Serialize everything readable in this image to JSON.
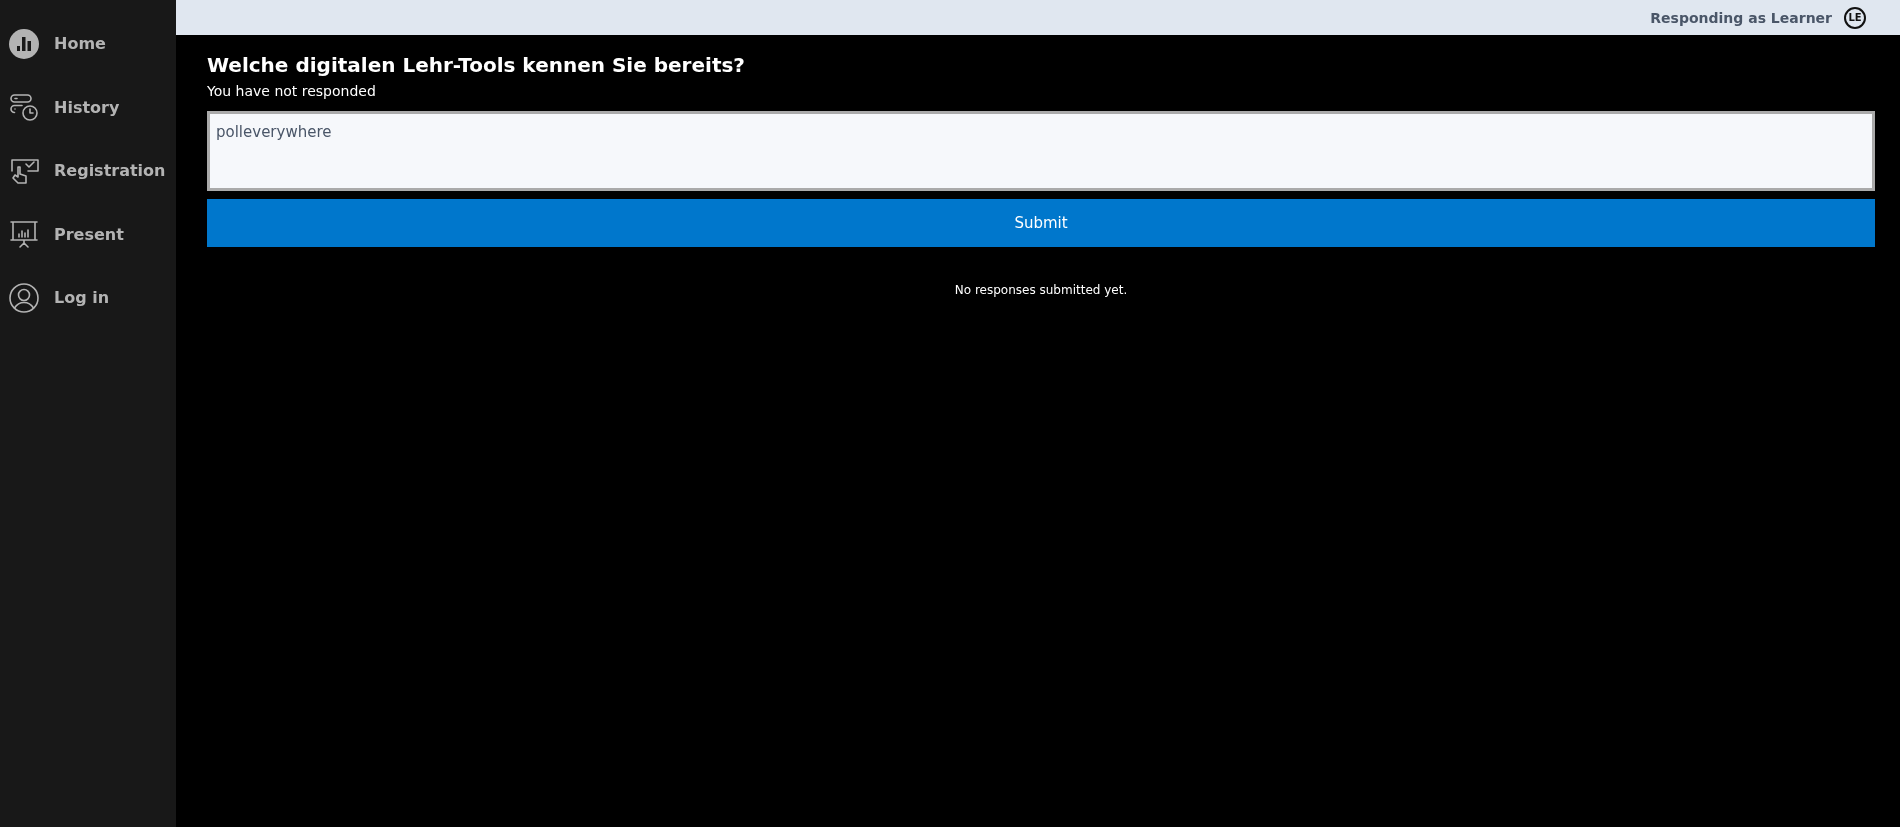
{
  "sidebar": {
    "items": [
      {
        "label": "Home"
      },
      {
        "label": "History"
      },
      {
        "label": "Registration"
      },
      {
        "label": "Present"
      },
      {
        "label": "Log in"
      }
    ]
  },
  "top_bar": {
    "status": "Responding as Learner",
    "avatar": "LE"
  },
  "question": {
    "title": "Welche digitalen Lehr-Tools kennen Sie bereits?",
    "status": "You have not responded",
    "answer": "polleverywhere",
    "submit": "Submit",
    "empty_message": "No responses submitted yet."
  }
}
